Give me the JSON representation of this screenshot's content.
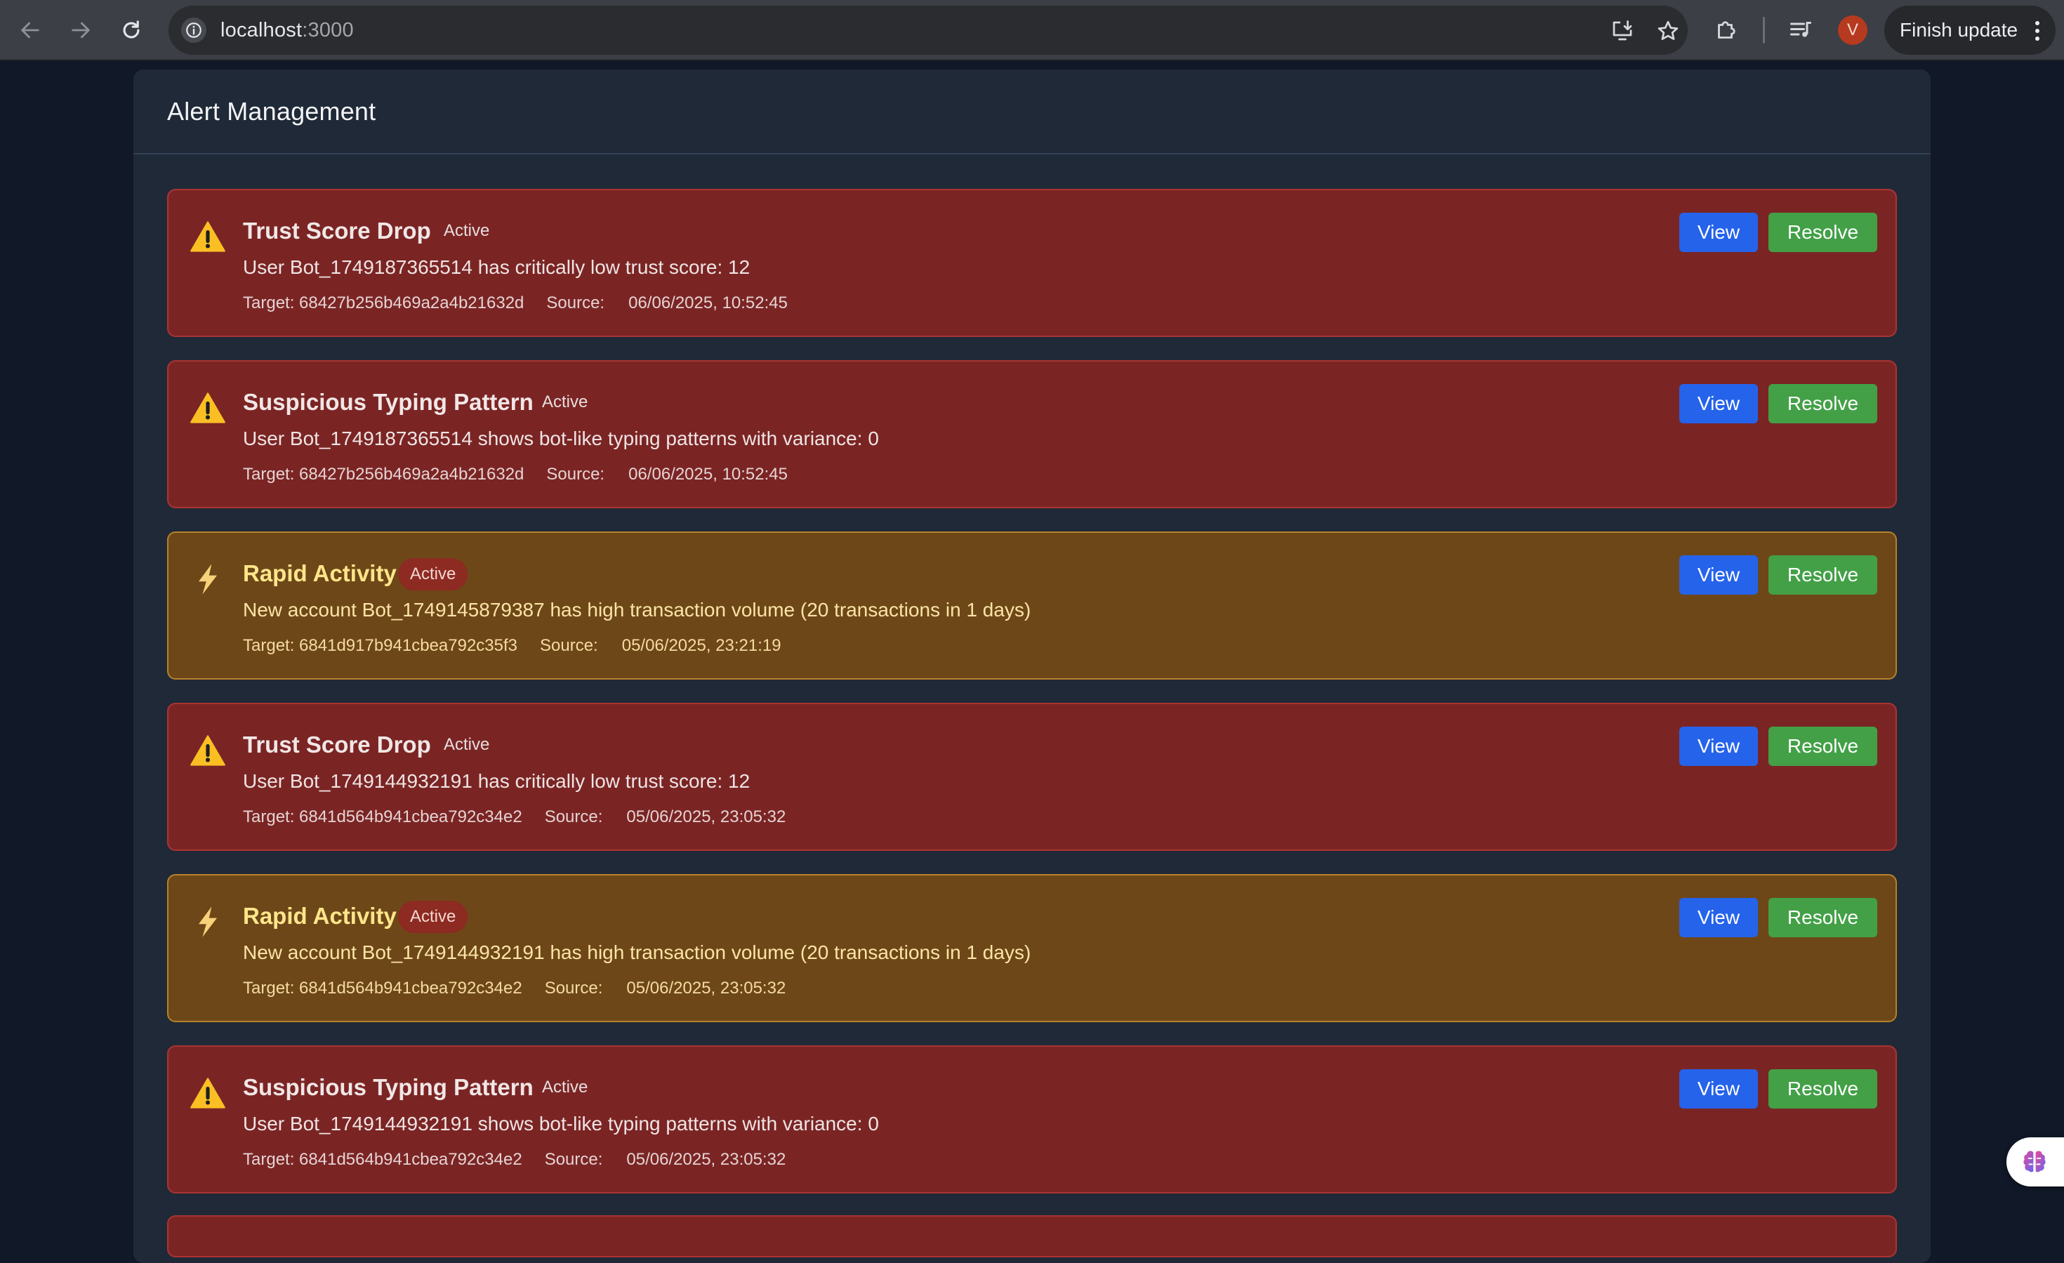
{
  "browser": {
    "url_host": "localhost",
    "url_port": ":3000",
    "avatar_initial": "V",
    "update_label": "Finish update"
  },
  "page": {
    "title": "Alert Management"
  },
  "actions": {
    "view_label": "View",
    "resolve_label": "Resolve"
  },
  "labels": {
    "target_prefix": "Target: ",
    "source_prefix": "Source:"
  },
  "colors": {
    "critical_bg": "#7a2524",
    "warning_bg": "#6e4718",
    "view_button": "#2563eb",
    "resolve_button": "#43a047"
  },
  "alerts": [
    {
      "icon": "warning-triangle-icon",
      "severity": "critical",
      "title": "Trust Score Drop",
      "status": "Active",
      "message": "User Bot_1749187365514 has critically low trust score: 12",
      "target": "68427b256b469a2a4b21632d",
      "timestamp": "06/06/2025, 10:52:45"
    },
    {
      "icon": "warning-triangle-icon",
      "severity": "critical",
      "title": "Suspicious Typing Pattern",
      "status": "Active",
      "message": "User Bot_1749187365514 shows bot-like typing patterns with variance: 0",
      "target": "68427b256b469a2a4b21632d",
      "timestamp": "06/06/2025, 10:52:45"
    },
    {
      "icon": "lightning-icon",
      "severity": "warning",
      "title": "Rapid Activity",
      "status": "Active",
      "message": "New account Bot_1749145879387 has high transaction volume (20 transactions in 1 days)",
      "target": "6841d917b941cbea792c35f3",
      "timestamp": "05/06/2025, 23:21:19"
    },
    {
      "icon": "warning-triangle-icon",
      "severity": "critical",
      "title": "Trust Score Drop",
      "status": "Active",
      "message": "User Bot_1749144932191 has critically low trust score: 12",
      "target": "6841d564b941cbea792c34e2",
      "timestamp": "05/06/2025, 23:05:32"
    },
    {
      "icon": "lightning-icon",
      "severity": "warning",
      "title": "Rapid Activity",
      "status": "Active",
      "message": "New account Bot_1749144932191 has high transaction volume (20 transactions in 1 days)",
      "target": "6841d564b941cbea792c34e2",
      "timestamp": "05/06/2025, 23:05:32"
    },
    {
      "icon": "warning-triangle-icon",
      "severity": "critical",
      "title": "Suspicious Typing Pattern",
      "status": "Active",
      "message": "User Bot_1749144932191 shows bot-like typing patterns with variance: 0",
      "target": "6841d564b941cbea792c34e2",
      "timestamp": "05/06/2025, 23:05:32"
    }
  ]
}
